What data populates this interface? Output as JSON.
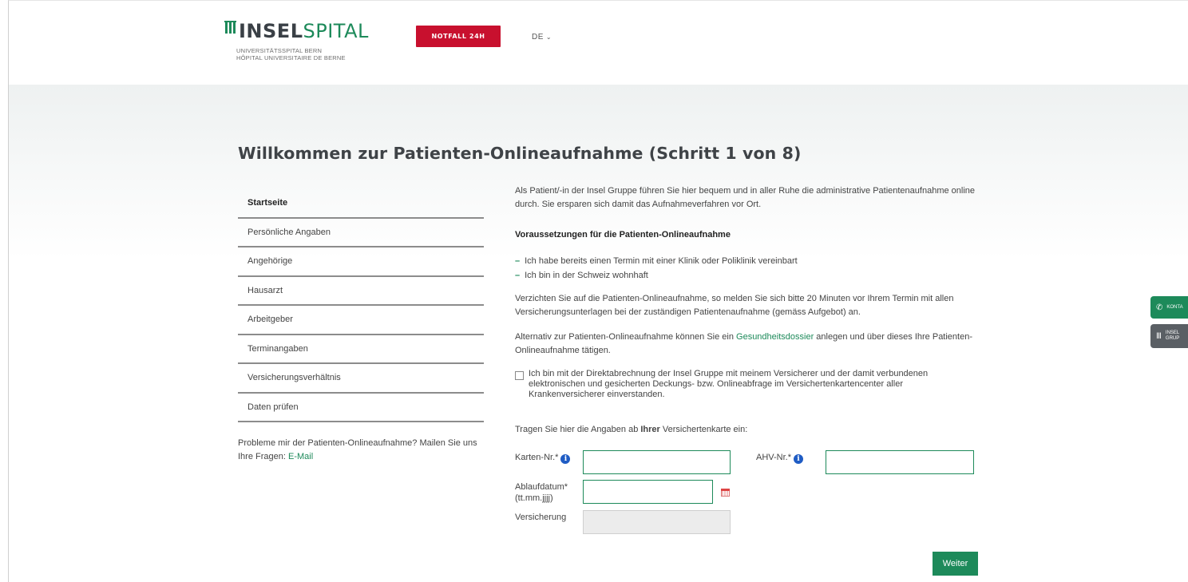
{
  "header": {
    "logo": {
      "word_1": "INSEL",
      "word_2": "SPITAL",
      "sub_1": "UNIVERSITÄTSSPITAL BERN",
      "sub_2": "HÔPITAL UNIVERSITAIRE DE BERNE"
    },
    "emergency_button": "NOTFALL 24H",
    "language": "DE"
  },
  "page_title": "Willkommen zur Patienten-Onlineaufnahme (Schritt 1 von 8)",
  "nav": {
    "items": [
      {
        "label": "Startseite",
        "active": true
      },
      {
        "label": "Persönliche Angaben"
      },
      {
        "label": "Angehörige"
      },
      {
        "label": "Hausarzt"
      },
      {
        "label": "Arbeitgeber"
      },
      {
        "label": "Terminangaben"
      },
      {
        "label": "Versicherungsverhältnis"
      },
      {
        "label": "Daten prüfen"
      }
    ],
    "help_text": "Probleme mir der Patienten-Onlineaufnahme? Mailen Sie uns Ihre Fragen: ",
    "help_link": "E-Mail"
  },
  "content": {
    "intro": "Als Patient/-in der Insel Gruppe führen Sie hier bequem und in aller Ruhe die administrative Patientenaufnahme online durch. Sie ersparen sich damit das Aufnahmeverfahren vor Ort.",
    "requirements_title": "Voraussetzungen für die Patienten-Onlineaufnahme",
    "requirements": [
      "Ich habe bereits einen Termin mit einer Klinik oder Poliklinik vereinbart",
      "Ich bin in der Schweiz wohnhaft"
    ],
    "waive_text": "Verzichten Sie auf die Patienten-Onlineaufnahme, so melden Sie sich bitte 20 Minuten vor Ihrem Termin mit allen Versicherungsunterlagen bei der zuständigen Patientenaufnahme (gemäss Aufgebot) an.",
    "alt_before": "Alternativ zur Patienten-Onlineaufnahme können Sie ein ",
    "alt_link": "Gesundheitsdossier",
    "alt_after": " anlegen und über dieses Ihre Patienten-Onlineaufnahme tätigen.",
    "consent": "Ich bin mit der Direktabrechnung der Insel Gruppe mit meinem Versicherer und der damit verbundenen elektronischen und gesicherten Deckungs- bzw. Onlineabfrage im Versichertenkartencenter aller Krankenversicherer einverstanden.",
    "card_intro_before": "Tragen Sie hier die Angaben ab ",
    "card_intro_bold": "Ihrer",
    "card_intro_after": " Versichertenkarte ein:"
  },
  "form": {
    "card_number_label": "Karten-Nr.*",
    "card_number_value": "",
    "ahv_label": "AHV-Nr.*",
    "ahv_value": "",
    "expiry_label": "Ablaufdatum*",
    "expiry_hint": "(tt.mm.jjjj)",
    "expiry_value": "",
    "insurance_label": "Versicherung",
    "insurance_value": "",
    "info_icon": "i"
  },
  "submit_button": "Weiter",
  "side_tabs": {
    "contact": "KONTA",
    "group_1": "INSEL",
    "group_2": "GRUP"
  },
  "colors": {
    "brand_green": "#1d8a5a",
    "emergency_red": "#c8102e",
    "info_blue": "#1f5cc4"
  }
}
